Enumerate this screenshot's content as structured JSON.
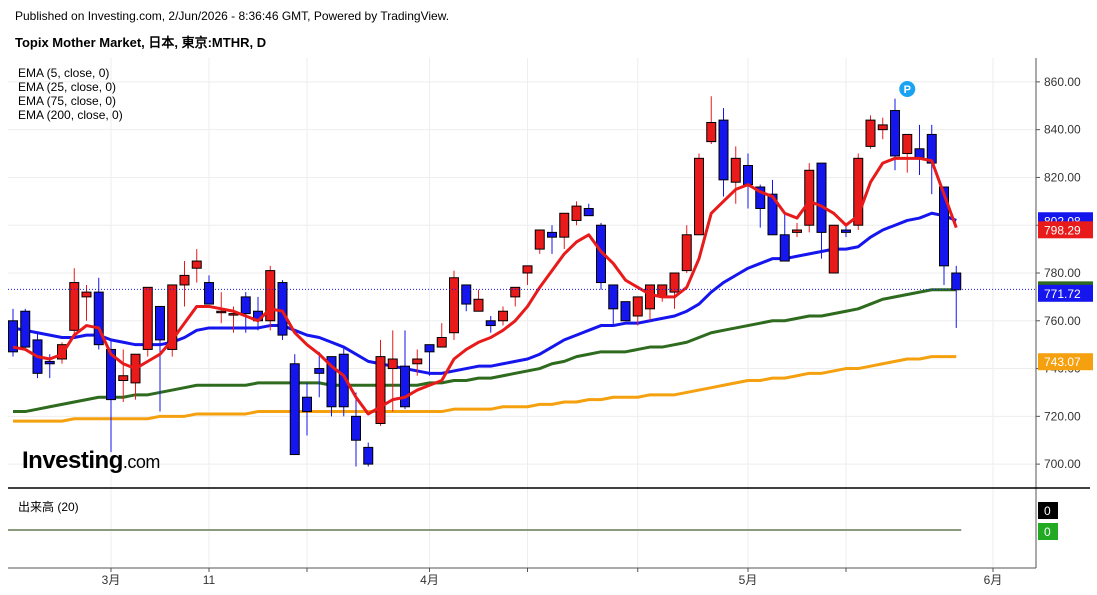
{
  "header": {
    "published": "Published on Investing.com, 2/Jun/2026 - 8:36:46 GMT, Powered by TradingView.",
    "title": "Topix Mother Market, 日本, 東京:MTHR, D"
  },
  "logo": {
    "main": "Investing",
    "suffix": ".com"
  },
  "legend": [
    "EMA (5, close, 0)",
    "EMA (25, close, 0)",
    "EMA (75, close, 0)",
    "EMA (200, close, 0)"
  ],
  "volume_label": "出来高 (20)",
  "marker": "P",
  "colors": {
    "up": "#e81a1a",
    "down": "#1515ee",
    "ema5": "#e81a1a",
    "ema25": "#1515ee",
    "ema75": "#2e6b1e",
    "ema200": "#f5a00f",
    "volume_line": "#8a9a7a"
  },
  "chart_data": {
    "type": "candlestick",
    "title": "Topix Mother Market, 日本, 東京:MTHR, D",
    "ylim": [
      690,
      870
    ],
    "yticks": [
      700,
      720,
      740,
      760,
      780,
      800,
      820,
      840,
      860
    ],
    "ytick_labels": [
      "700.00",
      "720.00",
      "740.00",
      "760.00",
      "780.00",
      "800.00",
      "820.00",
      "840.00",
      "860.00"
    ],
    "xtick_labels": [
      {
        "label": "3月",
        "index": 8
      },
      {
        "label": "11",
        "index": 16
      },
      {
        "label": "",
        "index": 24
      },
      {
        "label": "4月",
        "index": 34
      },
      {
        "label": "",
        "index": 42
      },
      {
        "label": "",
        "index": 51
      },
      {
        "label": "5月",
        "index": 60
      },
      {
        "label": "",
        "index": 68
      },
      {
        "label": "6月",
        "index": 80
      }
    ],
    "candles": [
      [
        760,
        765,
        745,
        747
      ],
      [
        764,
        765,
        748,
        749
      ],
      [
        752,
        755,
        736,
        738
      ],
      [
        743,
        746,
        736,
        742
      ],
      [
        744,
        751,
        742,
        750
      ],
      [
        756,
        782,
        754,
        776
      ],
      [
        770,
        775,
        760,
        772
      ],
      [
        772,
        778,
        748,
        750
      ],
      [
        748,
        752,
        705,
        727
      ],
      [
        735,
        748,
        726,
        737
      ],
      [
        734,
        745,
        727,
        746
      ],
      [
        748,
        772,
        745,
        774
      ],
      [
        766,
        766,
        722,
        752
      ],
      [
        748,
        775,
        745,
        775
      ],
      [
        775,
        785,
        766,
        779
      ],
      [
        782,
        790,
        776,
        785
      ],
      [
        776,
        779,
        767,
        767
      ],
      [
        764,
        772,
        759,
        764
      ],
      [
        763,
        766,
        755,
        763
      ],
      [
        770,
        772,
        755,
        763
      ],
      [
        764,
        770,
        756,
        760
      ],
      [
        760,
        783,
        756,
        781
      ],
      [
        776,
        777,
        752,
        754
      ],
      [
        742,
        746,
        706,
        704
      ],
      [
        728,
        734,
        712,
        722
      ],
      [
        740,
        747,
        728,
        738
      ],
      [
        745,
        745,
        720,
        724
      ],
      [
        746,
        749,
        720,
        724
      ],
      [
        720,
        730,
        699,
        710
      ],
      [
        707,
        709,
        699,
        700
      ],
      [
        717,
        752,
        716,
        745
      ],
      [
        740,
        756,
        722,
        744
      ],
      [
        741,
        756,
        723,
        724
      ],
      [
        742,
        748,
        737,
        744
      ],
      [
        750,
        750,
        737,
        747
      ],
      [
        749,
        759,
        749,
        753
      ],
      [
        755,
        781,
        752,
        778
      ],
      [
        775,
        775,
        764,
        767
      ],
      [
        764,
        773,
        764,
        769
      ],
      [
        760,
        762,
        755,
        758
      ],
      [
        760,
        766,
        758,
        764
      ],
      [
        770,
        772,
        766,
        774
      ],
      [
        780,
        783,
        775,
        783
      ],
      [
        790,
        794,
        788,
        798
      ],
      [
        797,
        800,
        788,
        795
      ],
      [
        795,
        800,
        790,
        805
      ],
      [
        802,
        810,
        800,
        808
      ],
      [
        807,
        809,
        805,
        804
      ],
      [
        800,
        801,
        773,
        776
      ],
      [
        775,
        775,
        758,
        765
      ],
      [
        768,
        768,
        762,
        760
      ],
      [
        762,
        762,
        758,
        770
      ],
      [
        765,
        775,
        760,
        775
      ],
      [
        770,
        775,
        768,
        775
      ],
      [
        772,
        775,
        765,
        780
      ],
      [
        781,
        800,
        780,
        796
      ],
      [
        796,
        830,
        796,
        828
      ],
      [
        835,
        854,
        834,
        843
      ],
      [
        844,
        849,
        812,
        819
      ],
      [
        818,
        833,
        809,
        828
      ],
      [
        825,
        830,
        807,
        817
      ],
      [
        816,
        817,
        799,
        807
      ],
      [
        813,
        819,
        798,
        796
      ],
      [
        796,
        805,
        796,
        785
      ],
      [
        797,
        801,
        795,
        798
      ],
      [
        800,
        826,
        797,
        823
      ],
      [
        826,
        826,
        786,
        797
      ],
      [
        780,
        798,
        784,
        800
      ],
      [
        798,
        800,
        795,
        797
      ],
      [
        800,
        830,
        798,
        828
      ],
      [
        833,
        846,
        832,
        844
      ],
      [
        840,
        845,
        836,
        842
      ],
      [
        848,
        853,
        823,
        829
      ],
      [
        830,
        836,
        822,
        838
      ],
      [
        832,
        842,
        821,
        828
      ],
      [
        838,
        842,
        813,
        826
      ],
      [
        816,
        816,
        775,
        783
      ],
      [
        780,
        783,
        757,
        773
      ]
    ],
    "ema5": [
      749,
      748,
      745,
      744,
      746,
      754,
      758,
      757,
      746,
      742,
      740,
      743,
      746,
      752,
      759,
      766,
      766,
      765,
      764,
      762,
      760,
      765,
      764,
      755,
      750,
      746,
      741,
      737,
      728,
      721,
      724,
      727,
      728,
      731,
      733,
      735,
      744,
      748,
      751,
      753,
      756,
      760,
      766,
      774,
      781,
      788,
      793,
      796,
      789,
      784,
      777,
      774,
      771,
      770,
      770,
      774,
      786,
      805,
      810,
      815,
      817,
      814,
      812,
      805,
      803,
      810,
      808,
      805,
      800,
      804,
      818,
      826,
      828,
      828,
      828,
      827,
      813,
      799
    ],
    "ema25": [
      757,
      756,
      755,
      754,
      753,
      753,
      754,
      754,
      752,
      751,
      750,
      750,
      750,
      751,
      753,
      756,
      757,
      757,
      757,
      757,
      757,
      758,
      758,
      756,
      754,
      753,
      751,
      749,
      746,
      743,
      742,
      741,
      740,
      739,
      738,
      738,
      739,
      740,
      741,
      741,
      742,
      743,
      744,
      746,
      749,
      752,
      754,
      756,
      758,
      758,
      759,
      759,
      760,
      761,
      762,
      764,
      767,
      772,
      776,
      779,
      782,
      784,
      786,
      786,
      787,
      788,
      789,
      790,
      790,
      791,
      795,
      798,
      800,
      802,
      803,
      805,
      804,
      802
    ],
    "ema75": [
      722,
      722,
      723,
      724,
      725,
      726,
      727,
      728,
      728,
      728,
      729,
      729,
      730,
      731,
      732,
      733,
      733,
      733,
      733,
      733,
      734,
      734,
      734,
      734,
      734,
      734,
      733,
      733,
      733,
      733,
      733,
      733,
      733,
      733,
      734,
      734,
      735,
      735,
      736,
      736,
      737,
      738,
      739,
      740,
      742,
      743,
      745,
      746,
      747,
      747,
      747,
      748,
      749,
      749,
      750,
      751,
      753,
      755,
      756,
      757,
      758,
      759,
      760,
      760,
      761,
      762,
      762,
      763,
      764,
      765,
      767,
      769,
      770,
      771,
      772,
      773,
      773,
      773
    ],
    "ema200": [
      718,
      718,
      718,
      718,
      718,
      719,
      719,
      719,
      719,
      719,
      719,
      719,
      720,
      720,
      720,
      721,
      721,
      721,
      721,
      721,
      722,
      722,
      722,
      722,
      722,
      722,
      722,
      722,
      722,
      722,
      722,
      722,
      722,
      722,
      722,
      722,
      723,
      723,
      723,
      723,
      724,
      724,
      724,
      725,
      725,
      726,
      726,
      727,
      727,
      728,
      728,
      728,
      729,
      729,
      729,
      730,
      731,
      732,
      733,
      734,
      735,
      735,
      736,
      736,
      737,
      738,
      738,
      739,
      740,
      740,
      741,
      742,
      743,
      744,
      744,
      745,
      745,
      745
    ],
    "price_labels": [
      {
        "value": "802.08",
        "level": 802.08,
        "color": "#1515ee"
      },
      {
        "value": "798.29",
        "level": 798.29,
        "color": "#e81a1a"
      },
      {
        "value": "773.15",
        "level": 773.15,
        "color": "#2e6b1e"
      },
      {
        "value": "771.72",
        "level": 771.72,
        "color": "#1515ee"
      },
      {
        "value": "743.07",
        "level": 743.07,
        "color": "#f5a00f"
      }
    ],
    "last_close": 773.15,
    "marker_index": 73,
    "volume": {
      "label": "出来高 (20)",
      "values": [
        0,
        0
      ],
      "badge_colors": [
        "#000000",
        "#22aa22"
      ]
    }
  }
}
